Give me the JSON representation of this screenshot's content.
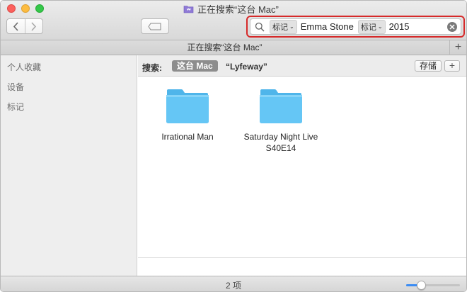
{
  "window": {
    "title": "正在搜索“这台 Mac”",
    "title_icon": "smart-folder-icon"
  },
  "toolbar": {
    "back_icon": "chevron-left-icon",
    "forward_icon": "chevron-right-icon",
    "tag_icon": "tag-icon",
    "search": {
      "icon": "magnifier-icon",
      "tokens": [
        {
          "kind": "标记",
          "value": "Emma Stone"
        },
        {
          "kind": "标记",
          "value": "2015"
        }
      ],
      "clear_icon": "clear-icon",
      "highlight_color": "#d62a2a"
    }
  },
  "tabbar": {
    "tab_label": "正在搜索“这台 Mac”",
    "add_tab": "+"
  },
  "sidebar": {
    "items": [
      {
        "label": "个人收藏"
      },
      {
        "label": "设备"
      },
      {
        "label": "标记"
      }
    ]
  },
  "scopebar": {
    "label": "搜索:",
    "scope_this_mac": "这台 Mac",
    "scope_folder": "“Lyfeway”",
    "save_label": "存储",
    "add_label": "+"
  },
  "files": [
    {
      "name": "Irrational Man",
      "icon": "folder-icon"
    },
    {
      "name": "Saturday Night Live\nS40E14",
      "icon": "folder-icon"
    }
  ],
  "statusbar": {
    "item_count": "2 项",
    "zoom_level": 0.27
  },
  "colors": {
    "folder": "#5cc2f2",
    "accent": "#3b8cf4"
  }
}
